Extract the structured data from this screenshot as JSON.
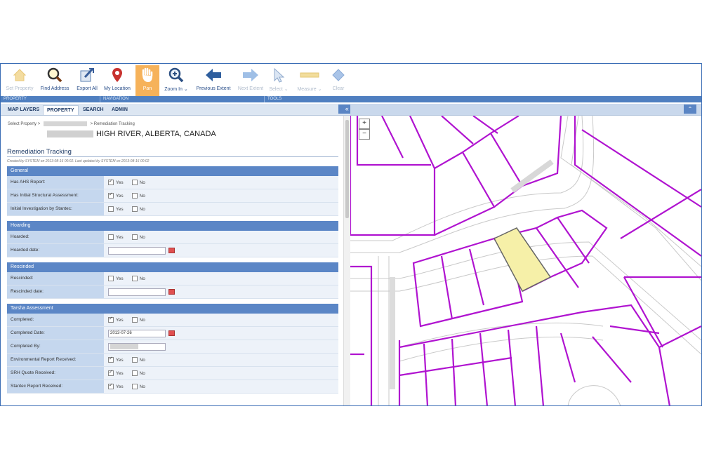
{
  "toolbar": {
    "tools": [
      {
        "label": "Set Property",
        "icon": "house-icon"
      },
      {
        "label": "Find Address",
        "icon": "magnifier-icon"
      },
      {
        "label": "Export All",
        "icon": "export-icon"
      },
      {
        "label": "My Location",
        "icon": "location-pin-icon"
      },
      {
        "label": "Pan",
        "icon": "hand-icon"
      },
      {
        "label": "Zoom In",
        "icon": "zoom-in-icon"
      },
      {
        "label": "Previous Extent",
        "icon": "arrow-left-icon"
      },
      {
        "label": "Next Extent",
        "icon": "arrow-right-icon"
      },
      {
        "label": "Select",
        "icon": "cursor-icon"
      },
      {
        "label": "Measure",
        "icon": "ruler-icon"
      },
      {
        "label": "Clear",
        "icon": "eraser-icon"
      }
    ],
    "groups": [
      "PROPERTY",
      "NAVIGATION",
      "TOOLS"
    ]
  },
  "tabs": [
    "MAP LAYERS",
    "PROPERTY",
    "SEARCH",
    "ADMIN"
  ],
  "panel": {
    "breadcrumb_start": "Select Property",
    "breadcrumb_sep": ">",
    "breadcrumb_end": "Remediation Tracking",
    "address": "HIGH RIVER, ALBERTA, CANADA",
    "title": "Remediation Tracking",
    "meta": "Created by SYSTEM on 2013-08-16 00:02. Last updated by SYSTEM on 2013-08-16 00:02",
    "yes": "Yes",
    "no": "No",
    "sections": {
      "general": {
        "title": "General",
        "r1": "Has AHS Report:",
        "r2": "Has Initial Structural Assessment:",
        "r3": "Initial Investigation by Stantec:"
      },
      "hoarding": {
        "title": "Hoarding",
        "r1": "Hoarded:",
        "r2": "Hoarded date:"
      },
      "rescinded": {
        "title": "Rescinded",
        "r1": "Rescinded:",
        "r2": "Rescinded date:"
      },
      "tarsha": {
        "title": "Tarsha Assessment",
        "r1": "Completed:",
        "r2": "Completed Date:",
        "r2_value": "2013-07-26",
        "r3": "Completed By:",
        "r4": "Environmental Report Received:",
        "r5": "SRH Quote Received:",
        "r6": "Stantec Report Received:"
      }
    }
  }
}
